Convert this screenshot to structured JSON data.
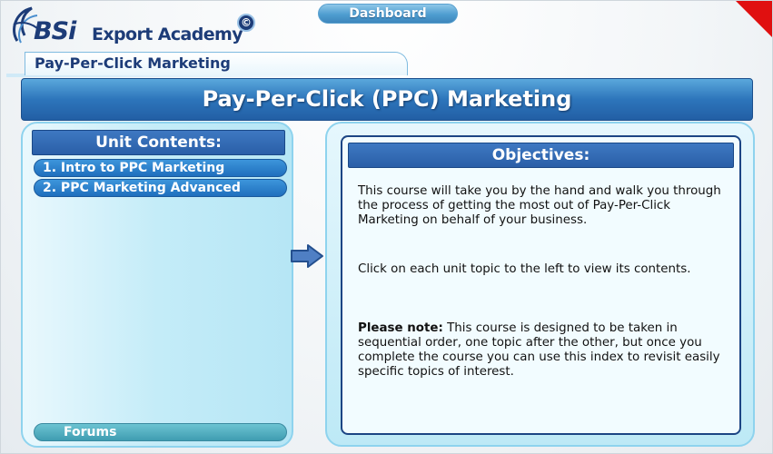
{
  "logo": {
    "brand": "BSi",
    "academy": "Export Academy",
    "copyright_symbol": "©"
  },
  "nav": {
    "dashboard_label": "Dashboard"
  },
  "breadcrumb": {
    "label": "Pay-Per-Click Marketing"
  },
  "page": {
    "title": "Pay-Per-Click (PPC) Marketing"
  },
  "unit_contents": {
    "header": "Unit Contents:",
    "items": [
      {
        "label": "1. Intro to PPC Marketing"
      },
      {
        "label": "2. PPC Marketing Advanced"
      }
    ],
    "forums_label": "Forums"
  },
  "objectives": {
    "header": "Objectives:",
    "paragraph1": "This course will take you by the hand and walk you through the process of getting the most out of Pay-Per-Click Marketing on behalf of your business.",
    "paragraph2": "Click on each unit topic to the left to view its contents.",
    "note_label": "Please note:",
    "note_text": " This course is designed to be taken in sequential order, one topic after the other, but once you complete the course you can use this index to revisit easily specific topics of interest."
  },
  "colors": {
    "brand_navy": "#1d3c78",
    "title_blue": "#2d75bb",
    "panel_cyan": "#b6e6f5",
    "corner_red": "#e01010"
  },
  "icons": [
    "logo-swirl-icon",
    "copyright-icon",
    "right-arrow-icon",
    "corner-flag-icon"
  ]
}
